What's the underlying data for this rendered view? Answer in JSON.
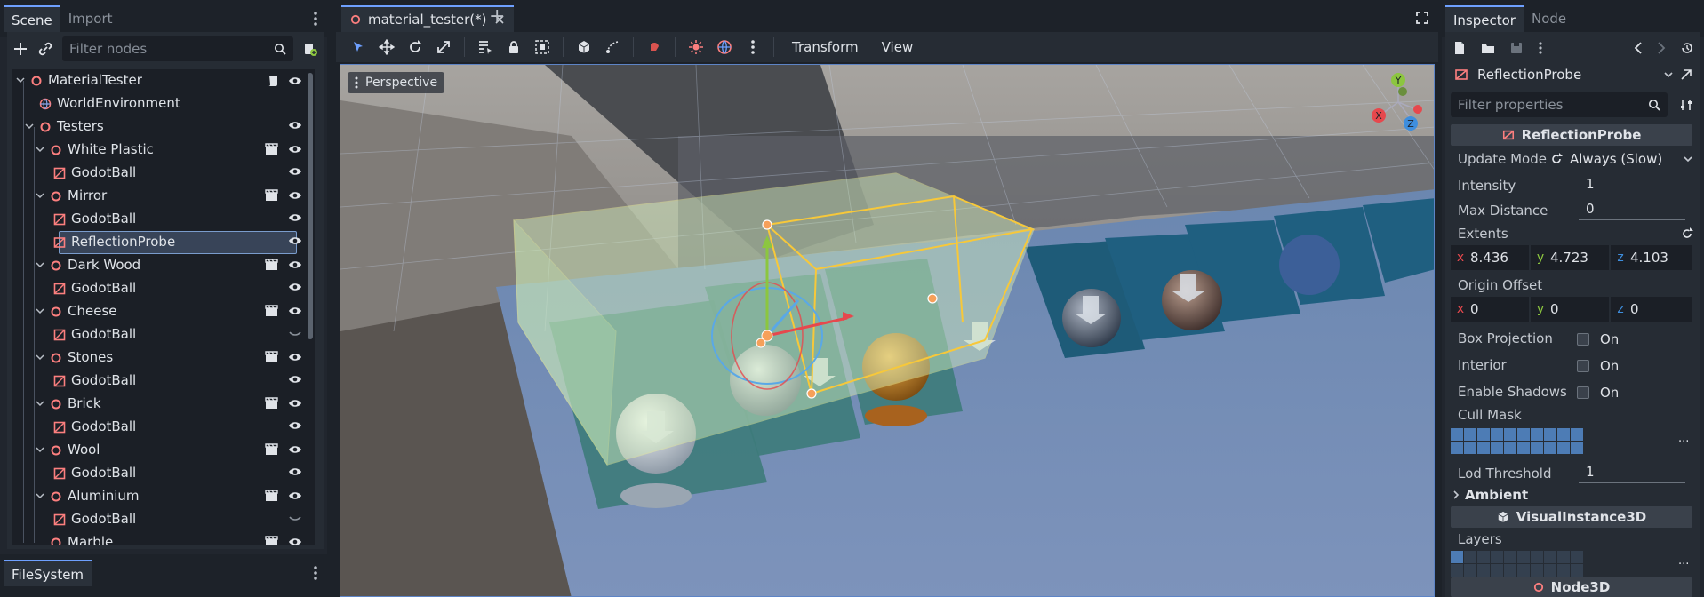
{
  "left_dock": {
    "tabs": [
      {
        "label": "Scene",
        "active": true
      },
      {
        "label": "Import",
        "active": false
      }
    ],
    "filter_placeholder": "Filter nodes",
    "tree": [
      {
        "label": "MaterialTester",
        "indent": 0,
        "kind": "node3d",
        "extra": "script",
        "visible": "eye"
      },
      {
        "label": "WorldEnvironment",
        "indent": 1,
        "kind": "world",
        "extra": "",
        "visible": ""
      },
      {
        "label": "Testers",
        "indent": 1,
        "kind": "node3d",
        "extra": "",
        "visible": "eye"
      },
      {
        "label": "White Plastic",
        "indent": 2,
        "kind": "node3d",
        "extra": "scene",
        "visible": "eye"
      },
      {
        "label": "GodotBall",
        "indent": 3,
        "kind": "mesh",
        "extra": "",
        "visible": "eye"
      },
      {
        "label": "Mirror",
        "indent": 2,
        "kind": "node3d",
        "extra": "scene",
        "visible": "eye"
      },
      {
        "label": "GodotBall",
        "indent": 3,
        "kind": "mesh",
        "extra": "",
        "visible": "eye"
      },
      {
        "label": "ReflectionProbe",
        "indent": 3,
        "kind": "probe",
        "extra": "",
        "visible": "eye",
        "selected": true
      },
      {
        "label": "Dark Wood",
        "indent": 2,
        "kind": "node3d",
        "extra": "scene",
        "visible": "eye"
      },
      {
        "label": "GodotBall",
        "indent": 3,
        "kind": "mesh",
        "extra": "",
        "visible": "eye"
      },
      {
        "label": "Cheese",
        "indent": 2,
        "kind": "node3d",
        "extra": "scene",
        "visible": "eye"
      },
      {
        "label": "GodotBall",
        "indent": 3,
        "kind": "mesh",
        "extra": "",
        "visible": "hidden"
      },
      {
        "label": "Stones",
        "indent": 2,
        "kind": "node3d",
        "extra": "scene",
        "visible": "eye"
      },
      {
        "label": "GodotBall",
        "indent": 3,
        "kind": "mesh",
        "extra": "",
        "visible": "eye"
      },
      {
        "label": "Brick",
        "indent": 2,
        "kind": "node3d",
        "extra": "scene",
        "visible": "eye"
      },
      {
        "label": "GodotBall",
        "indent": 3,
        "kind": "mesh",
        "extra": "",
        "visible": "eye"
      },
      {
        "label": "Wool",
        "indent": 2,
        "kind": "node3d",
        "extra": "scene",
        "visible": "eye"
      },
      {
        "label": "GodotBall",
        "indent": 3,
        "kind": "mesh",
        "extra": "",
        "visible": "eye"
      },
      {
        "label": "Aluminium",
        "indent": 2,
        "kind": "node3d",
        "extra": "scene",
        "visible": "eye"
      },
      {
        "label": "GodotBall",
        "indent": 3,
        "kind": "mesh",
        "extra": "",
        "visible": "hidden"
      },
      {
        "label": "Marble",
        "indent": 2,
        "kind": "node3d",
        "extra": "scene",
        "visible": "eye"
      }
    ],
    "filesystem_tab": "FileSystem"
  },
  "center": {
    "scene_tab_label": "material_tester(*)",
    "add_tab": "+",
    "menus": {
      "transform": "Transform",
      "view": "View"
    },
    "viewport_label": "Perspective",
    "gizmo": {
      "y": "Y",
      "x": "X",
      "z": "Z"
    }
  },
  "inspector": {
    "tabs": [
      {
        "label": "Inspector",
        "active": true
      },
      {
        "label": "Node",
        "active": false
      }
    ],
    "object_name": "ReflectionProbe",
    "filter_placeholder": "Filter properties",
    "section_main": "ReflectionProbe",
    "update_mode": {
      "label": "Update Mode",
      "value": "Always (Slow)"
    },
    "intensity": {
      "label": "Intensity",
      "value": "1"
    },
    "max_distance": {
      "label": "Max Distance",
      "value": "0"
    },
    "extents": {
      "label": "Extents",
      "x": "8.436",
      "y": "4.723",
      "z": "4.103"
    },
    "origin_offset": {
      "label": "Origin Offset",
      "x": "0",
      "y": "0",
      "z": "0"
    },
    "box_projection": {
      "label": "Box Projection",
      "value": "On"
    },
    "interior": {
      "label": "Interior",
      "value": "On"
    },
    "enable_shadows": {
      "label": "Enable Shadows",
      "value": "On"
    },
    "cull_mask": {
      "label": "Cull Mask",
      "more": "..."
    },
    "lod_threshold": {
      "label": "Lod Threshold",
      "value": "1"
    },
    "ambient": "Ambient",
    "section_visual": "VisualInstance3D",
    "layers": {
      "label": "Layers",
      "more": "..."
    },
    "section_node3d": "Node3D",
    "axes": {
      "x": "x",
      "y": "y",
      "z": "z"
    }
  },
  "colors": {
    "accent": "#6ea0ff",
    "node3d": "#fc7f7f",
    "axis_x": "#e6484d",
    "axis_y": "#8cc63f",
    "axis_z": "#3e8ede",
    "probe_box": "#f7c83a"
  }
}
